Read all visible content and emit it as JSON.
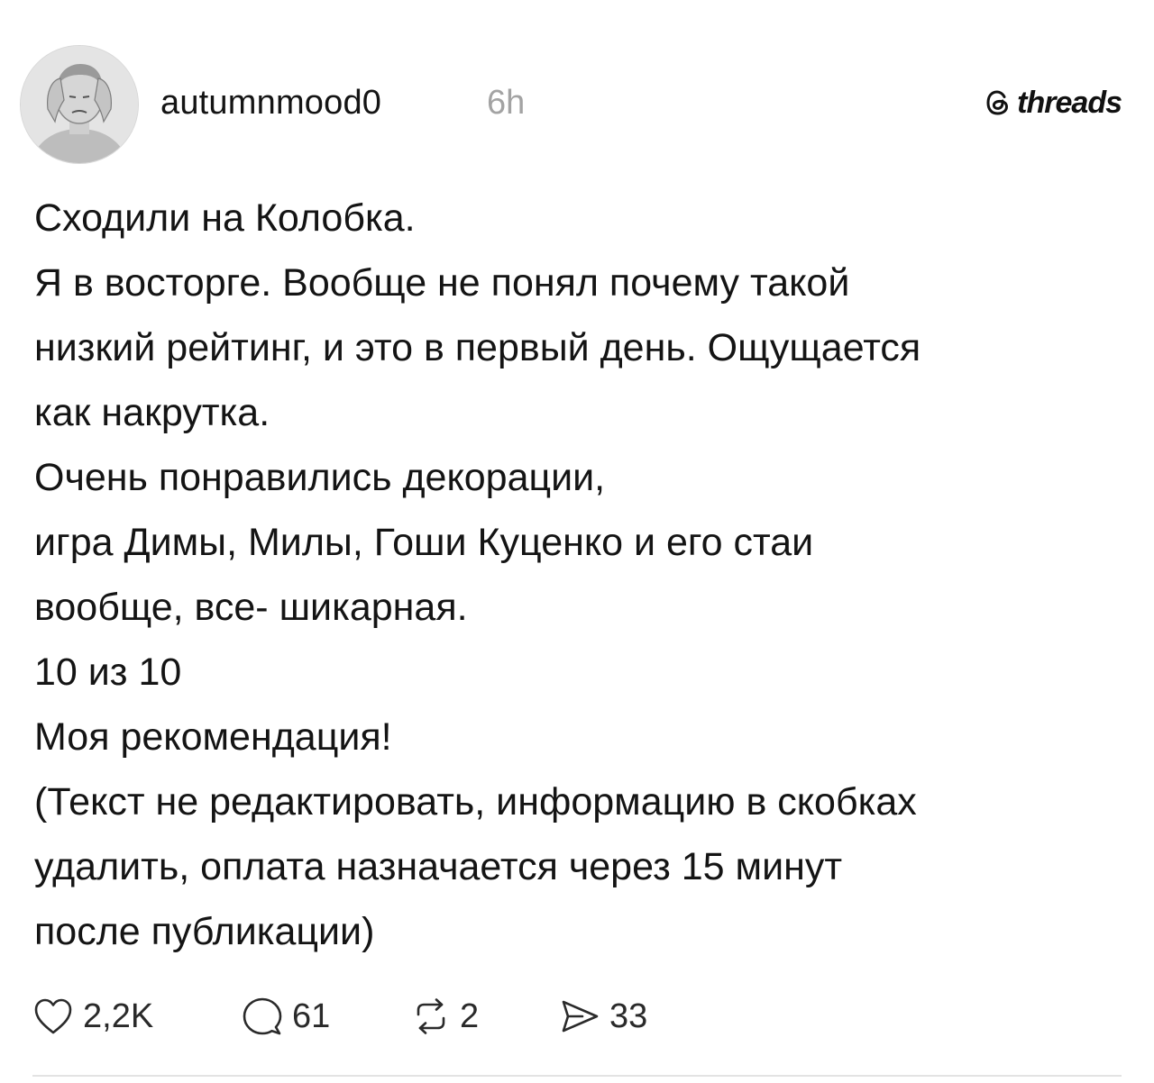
{
  "post": {
    "username": "autumnmood0",
    "timestamp": "6h",
    "brand": "threads",
    "avatar_icon": "profile-photo",
    "body_lines": [
      "Сходили на Колобка.",
      "Я в восторге. Вообще не понял почему такой",
      "низкий рейтинг, и это в первый день. Ощущается",
      "как накрутка.",
      "Очень понравились декорации,",
      "игра Димы, Милы, Гоши Куценко и его стаи",
      "вообще, все- шикарная.",
      "10 из 10",
      "Моя рекомендация!",
      "(Текст не редактировать, информацию в скобках",
      "удалить, оплата назначается через 15 минут",
      "после публикации)"
    ],
    "actions": {
      "likes": "2,2K",
      "comments": "61",
      "reposts": "2",
      "shares": "33"
    },
    "icons": {
      "like": "heart-icon",
      "comment": "comment-icon",
      "repost": "repost-icon",
      "share": "send-icon"
    }
  }
}
